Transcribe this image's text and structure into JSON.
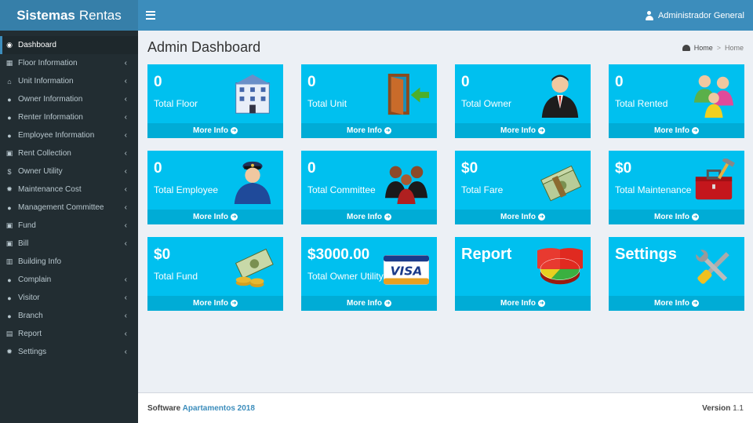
{
  "header": {
    "logo_bold": "Sistemas",
    "logo_rest": "Rentas",
    "user": "Administrador General"
  },
  "sidebar": {
    "items": [
      {
        "label": "Dashboard",
        "icon": "dashboard-icon",
        "glyph": "◉",
        "chevron": false
      },
      {
        "label": "Floor Information",
        "icon": "building-icon",
        "glyph": "▦",
        "chevron": true
      },
      {
        "label": "Unit Information",
        "icon": "home-icon",
        "glyph": "⌂",
        "chevron": true
      },
      {
        "label": "Owner Information",
        "icon": "user-icon",
        "glyph": "●",
        "chevron": true
      },
      {
        "label": "Renter Information",
        "icon": "user-icon",
        "glyph": "●",
        "chevron": true
      },
      {
        "label": "Employee Information",
        "icon": "user-icon",
        "glyph": "●",
        "chevron": true
      },
      {
        "label": "Rent Collection",
        "icon": "money-icon",
        "glyph": "▣",
        "chevron": true
      },
      {
        "label": "Owner Utility",
        "icon": "dollar-icon",
        "glyph": "$",
        "chevron": true
      },
      {
        "label": "Maintenance Cost",
        "icon": "gear-icon",
        "glyph": "✹",
        "chevron": true
      },
      {
        "label": "Management Committee",
        "icon": "user-icon",
        "glyph": "●",
        "chevron": true
      },
      {
        "label": "Fund",
        "icon": "money-icon",
        "glyph": "▣",
        "chevron": true
      },
      {
        "label": "Bill",
        "icon": "money-icon",
        "glyph": "▣",
        "chevron": true
      },
      {
        "label": "Building Info",
        "icon": "building-icon",
        "glyph": "▥",
        "chevron": false
      },
      {
        "label": "Complain",
        "icon": "user-icon",
        "glyph": "●",
        "chevron": true
      },
      {
        "label": "Visitor",
        "icon": "users-icon",
        "glyph": "●",
        "chevron": true
      },
      {
        "label": "Branch",
        "icon": "users-icon",
        "glyph": "●",
        "chevron": true
      },
      {
        "label": "Report",
        "icon": "chart-icon",
        "glyph": "▤",
        "chevron": true
      },
      {
        "label": "Settings",
        "icon": "gear-icon",
        "glyph": "✹",
        "chevron": true
      }
    ]
  },
  "content": {
    "title": "Admin Dashboard",
    "breadcrumb_home": "Home",
    "breadcrumb_current": "Home"
  },
  "boxes": [
    {
      "value": "0",
      "label": "Total Floor",
      "more": "More Info",
      "icon": "building-icon"
    },
    {
      "value": "0",
      "label": "Total Unit",
      "more": "More Info",
      "icon": "door-icon"
    },
    {
      "value": "0",
      "label": "Total Owner",
      "more": "More Info",
      "icon": "businessman-icon"
    },
    {
      "value": "0",
      "label": "Total Rented",
      "more": "More Info",
      "icon": "family-icon"
    },
    {
      "value": "0",
      "label": "Total Employee",
      "more": "More Info",
      "icon": "policeman-icon"
    },
    {
      "value": "0",
      "label": "Total Committee",
      "more": "More Info",
      "icon": "committee-icon"
    },
    {
      "value": "$0",
      "label": "Total Fare",
      "more": "More Info",
      "icon": "money-stack-icon"
    },
    {
      "value": "$0",
      "label": "Total Maintenance",
      "more": "More Info",
      "icon": "toolbox-icon"
    },
    {
      "value": "$0",
      "label": "Total Fund",
      "more": "More Info",
      "icon": "cash-coins-icon"
    },
    {
      "value": "$3000.00",
      "label": "Total Owner Utility",
      "more": "More Info",
      "icon": "visa-card-icon"
    },
    {
      "value": "Report",
      "label": "",
      "more": "More Info",
      "icon": "pie-chart-icon"
    },
    {
      "value": "Settings",
      "label": "",
      "more": "More Info",
      "icon": "tools-icon"
    }
  ],
  "footer": {
    "software": "Software",
    "brand": "Apartamentos 2018",
    "version_label": "Version",
    "version": "1.1"
  }
}
